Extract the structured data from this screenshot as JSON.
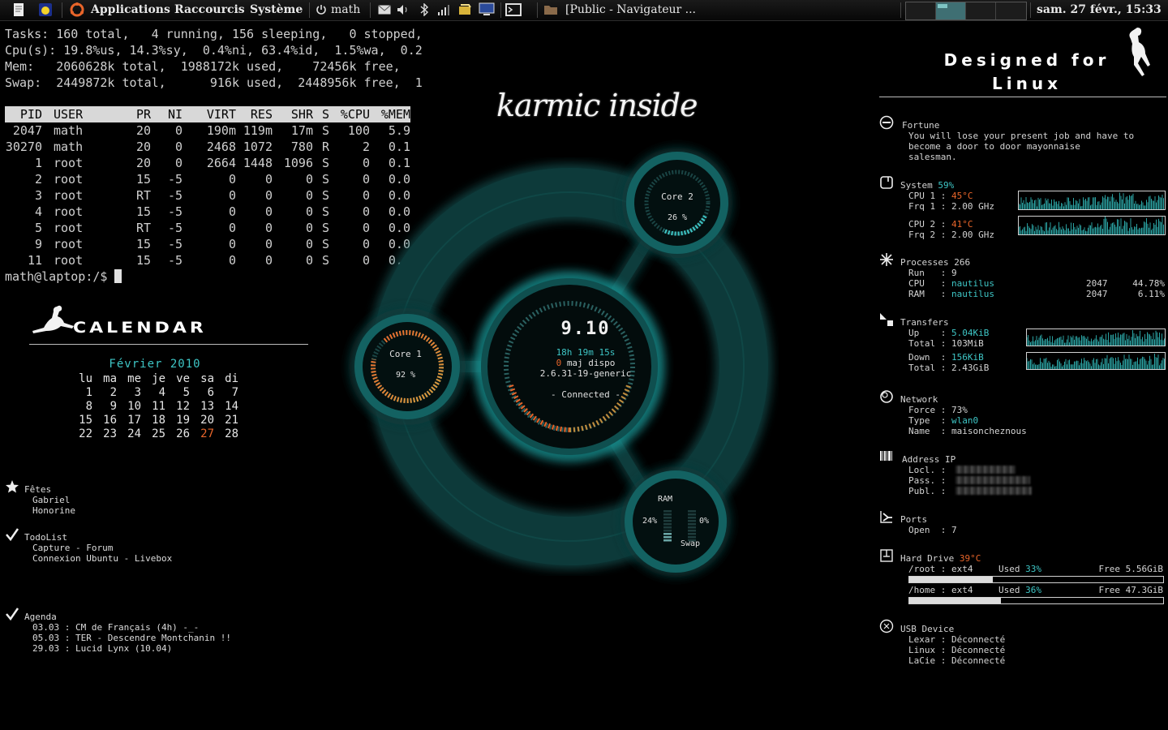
{
  "top_panel": {
    "menus": [
      "Applications",
      "Raccourcis",
      "Système"
    ],
    "user": "math",
    "window_task": "[Public - Navigateur ...",
    "clock": "sam. 27 févr., 15:33"
  },
  "terminal": {
    "summary": [
      "Tasks: 160 total,   4 running, 156 sleeping,   0 stopped,",
      "Cpu(s): 19.8%us, 14.3%sy,  0.4%ni, 63.4%id,  1.5%wa,  0.2",
      "Mem:   2060628k total,  1988172k used,    72456k free,",
      "Swap:  2449872k total,      916k used,  2448956k free,  1"
    ],
    "columns": [
      "PID",
      "USER",
      "PR",
      "NI",
      "VIRT",
      "RES",
      "SHR",
      "S",
      "%CPU",
      "%MEM"
    ],
    "rows": [
      [
        "2047",
        "math",
        "20",
        "0",
        "190m",
        "119m",
        "17m",
        "S",
        "100",
        "5.9"
      ],
      [
        "30270",
        "math",
        "20",
        "0",
        "2468",
        "1072",
        "780",
        "R",
        "2",
        "0.1"
      ],
      [
        "1",
        "root",
        "20",
        "0",
        "2664",
        "1448",
        "1096",
        "S",
        "0",
        "0.1"
      ],
      [
        "2",
        "root",
        "15",
        "-5",
        "0",
        "0",
        "0",
        "S",
        "0",
        "0.0"
      ],
      [
        "3",
        "root",
        "RT",
        "-5",
        "0",
        "0",
        "0",
        "S",
        "0",
        "0.0"
      ],
      [
        "4",
        "root",
        "15",
        "-5",
        "0",
        "0",
        "0",
        "S",
        "0",
        "0.0"
      ],
      [
        "5",
        "root",
        "RT",
        "-5",
        "0",
        "0",
        "0",
        "S",
        "0",
        "0.0"
      ],
      [
        "9",
        "root",
        "15",
        "-5",
        "0",
        "0",
        "0",
        "S",
        "0",
        "0.0"
      ],
      [
        "11",
        "root",
        "15",
        "-5",
        "0",
        "0",
        "0",
        "S",
        "0",
        "0.0"
      ]
    ],
    "prompt": "math@laptop:/$ "
  },
  "calendar": {
    "title": "Calendar",
    "month": "Février 2010",
    "weekdays": [
      "lu",
      "ma",
      "me",
      "je",
      "ve",
      "sa",
      "di"
    ],
    "weeks": [
      [
        "1",
        "2",
        "3",
        "4",
        "5",
        "6",
        "7"
      ],
      [
        "8",
        "9",
        "10",
        "11",
        "12",
        "13",
        "14"
      ],
      [
        "15",
        "16",
        "17",
        "18",
        "19",
        "20",
        "21"
      ],
      [
        "22",
        "23",
        "24",
        "25",
        "26",
        "27",
        "28"
      ]
    ],
    "today": "27"
  },
  "notes": {
    "fetes": {
      "title": "Fêtes",
      "lines": [
        "Gabriel",
        "Honorine"
      ]
    },
    "todo": {
      "title": "TodoList",
      "lines": [
        "Capture - Forum",
        "Connexion Ubuntu - Livebox"
      ]
    },
    "agenda": {
      "title": "Agenda",
      "lines": [
        "03.03 : CM de Français (4h) -_-",
        "05.03 : TER - Descendre Montchanin !!",
        "29.03 : Lucid Lynx (10.04)"
      ]
    }
  },
  "center": {
    "logo": "karmic inside",
    "version": "9.10",
    "uptime": "18h 19m 15s",
    "updates_count": "0",
    "updates_label": "maj dispo",
    "kernel": "2.6.31-19-generic",
    "status": "- Connected -",
    "core1": {
      "label": "Core 1",
      "value": "92 %",
      "level": 0.92
    },
    "core2": {
      "label": "Core 2",
      "value": "26 %",
      "level": 0.26
    },
    "ram": {
      "label": "RAM",
      "value": "24%",
      "level": 0.24
    },
    "swap": {
      "label": "Swap",
      "value": "0%",
      "level": 0.0
    }
  },
  "conky": {
    "designed_lines": [
      "Designed for",
      "Linux"
    ],
    "fortune": {
      "title": "Fortune",
      "lines": [
        "You will lose your present job and have to",
        "become a door to door mayonnaise",
        "salesman."
      ]
    },
    "system": {
      "title": "System",
      "pct": "59%",
      "cpu1_label": "CPU 1 :",
      "cpu1_temp": "45°C",
      "frq1_label": "Frq 1 :",
      "frq1": "2.00 GHz",
      "cpu2_label": "CPU 2 :",
      "cpu2_temp": "41°C",
      "frq2_label": "Frq 2 :",
      "frq2": "2.00 GHz"
    },
    "processes": {
      "title": "Processes",
      "count": "266",
      "run_label": "Run   :",
      "run": "9",
      "cpu_label": "CPU   :",
      "cpu_proc": "nautilus",
      "cpu_pid": "2047",
      "cpu_val": "44.78%",
      "ram_label": "RAM   :",
      "ram_proc": "nautilus",
      "ram_pid": "2047",
      "ram_val": "6.11%"
    },
    "transfers": {
      "title": "Transfers",
      "up_label": "Up    :",
      "up": "5.04KiB",
      "up_total_label": "Total :",
      "up_total": "103MiB",
      "down_label": "Down  :",
      "down": "156KiB",
      "down_total_label": "Total :",
      "down_total": "2.43GiB"
    },
    "network": {
      "title": "Network",
      "force_label": "Force :",
      "force": "73%",
      "type_label": "Type  :",
      "type": "wlan0",
      "name_label": "Name  :",
      "name": "maisoncheznous"
    },
    "address": {
      "title": "Address IP",
      "locl": "Locl. :",
      "pass": "Pass. :",
      "publ": "Publ. :"
    },
    "ports": {
      "title": "Ports",
      "open_label": "Open  :",
      "open": "7"
    },
    "hdd": {
      "title": "Hard Drive",
      "temp": "39°C",
      "root_label": "/root : ext4",
      "root_used_label": "Used",
      "root_used": "33%",
      "root_free": "Free 5.56GiB",
      "root_level": 0.33,
      "home_label": "/home : ext4",
      "home_used_label": "Used",
      "home_used": "36%",
      "home_free": "Free 47.3GiB",
      "home_level": 0.36
    },
    "usb": {
      "title": "USB Device",
      "lines": [
        "Lexar : Déconnecté",
        "Linux : Déconnecté",
        "LaCie : Déconnecté"
      ]
    }
  },
  "colors": {
    "accent": "#3ec6c6",
    "alert": "#e8652a",
    "ring": "#0d3c3c",
    "glow": "#1fa3a3"
  }
}
